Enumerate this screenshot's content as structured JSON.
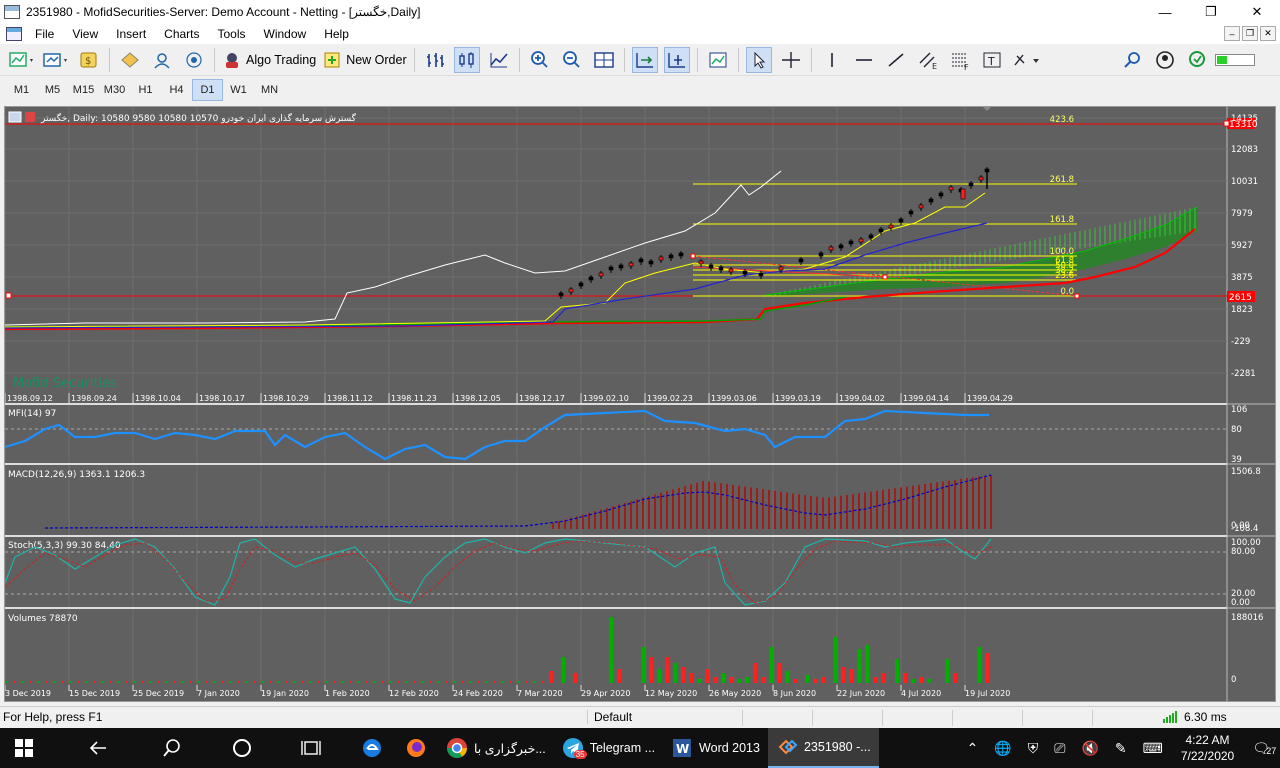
{
  "window": {
    "title": "2351980 - MofidSecurities-Server: Demo Account - Netting - [خگستر,Daily]",
    "buttons": [
      "—",
      "❐",
      "✕"
    ]
  },
  "menu": {
    "items": [
      "File",
      "View",
      "Insert",
      "Charts",
      "Tools",
      "Window",
      "Help"
    ],
    "mdi_buttons": [
      "–",
      "❐",
      "✕"
    ]
  },
  "toolbar": {
    "algo_trading": "Algo Trading",
    "new_order": "New Order"
  },
  "timeframes": {
    "items": [
      "M1",
      "M5",
      "M15",
      "M30",
      "H1",
      "H4",
      "D1",
      "W1",
      "MN"
    ],
    "active": "D1"
  },
  "chart": {
    "header": "خگستر, Daily:  10580 9580 10580 10570   گسترش سرمایه گذاری ایران خودرو",
    "watermark": "Mofid Securities",
    "price_axis": [
      "14135",
      "12083",
      "10031",
      "7979",
      "5927",
      "3875",
      "1823",
      "-229",
      "-2281"
    ],
    "price_tags": {
      "top": "13310",
      "bottom": "2615"
    },
    "fib_levels": [
      "423.6",
      "261.8",
      "161.8",
      "100.0",
      "61.8",
      "50.0",
      "38.2",
      "23.6",
      "0.0"
    ],
    "date_axis_top": [
      "1398.09.12",
      "1398.09.24",
      "1398.10.04",
      "1398.10.17",
      "1398.10.29",
      "1398.11.12",
      "1398.11.23",
      "1398.12.05",
      "1398.12.17",
      "1399.02.10",
      "1399.02.23",
      "1399.03.06",
      "1399.03.19",
      "1399.04.02",
      "1399.04.14",
      "1399.04.29"
    ],
    "date_axis_bottom": [
      "3 Dec 2019",
      "15 Dec 2019",
      "25 Dec 2019",
      "7 Jan 2020",
      "19 Jan 2020",
      "1 Feb 2020",
      "12 Feb 2020",
      "24 Feb 2020",
      "7 Mar 2020",
      "29 Apr 2020",
      "12 May 2020",
      "26 May 2020",
      "8 Jun 2020",
      "22 Jun 2020",
      "4 Jul 2020",
      "19 Jul 2020"
    ],
    "colors": {
      "bg": "#606060",
      "grid": "#7a7a7a",
      "price_line": "#ffffff",
      "ma_fast": "#ffff00",
      "ma_slow": "#2020d0",
      "cloud": "#00a000",
      "red_line": "#ff0000",
      "mfi": "#1e90ff",
      "macd_hist": "#c00000",
      "macd_signal": "#0000c0",
      "stoch_main": "#20b2aa",
      "stoch_signal": "#d02020",
      "vol_up": "#00b000",
      "vol_down": "#ff2020"
    }
  },
  "indicators": {
    "mfi": {
      "label": "MFI(14) 97",
      "axis": [
        "106",
        "80",
        "39"
      ]
    },
    "macd": {
      "label": "MACD(12,26,9) 1363.1 1206.3",
      "axis": [
        "1506.8",
        "0.00",
        "-108.4"
      ]
    },
    "stoch": {
      "label": "Stoch(5,3,3) 99.30 84.40",
      "axis": [
        "100.00",
        "80.00",
        "20.00",
        "0.00"
      ]
    },
    "volumes": {
      "label": "Volumes 78870",
      "axis": [
        "188016",
        "0"
      ]
    }
  },
  "status": {
    "help": "For Help, press F1",
    "profile": "Default",
    "ping": "6.30 ms"
  },
  "taskbar": {
    "apps": [
      {
        "label": "خبرگزاری با...",
        "icon": "chrome-icon"
      },
      {
        "label": "Telegram ...",
        "icon": "telegram-icon",
        "badge": "35"
      },
      {
        "label": "Word 2013",
        "icon": "word-icon"
      },
      {
        "label": "2351980 -...",
        "icon": "mt5-icon"
      }
    ],
    "time": "4:22 AM",
    "date": "7/22/2020",
    "notifications": "27"
  }
}
